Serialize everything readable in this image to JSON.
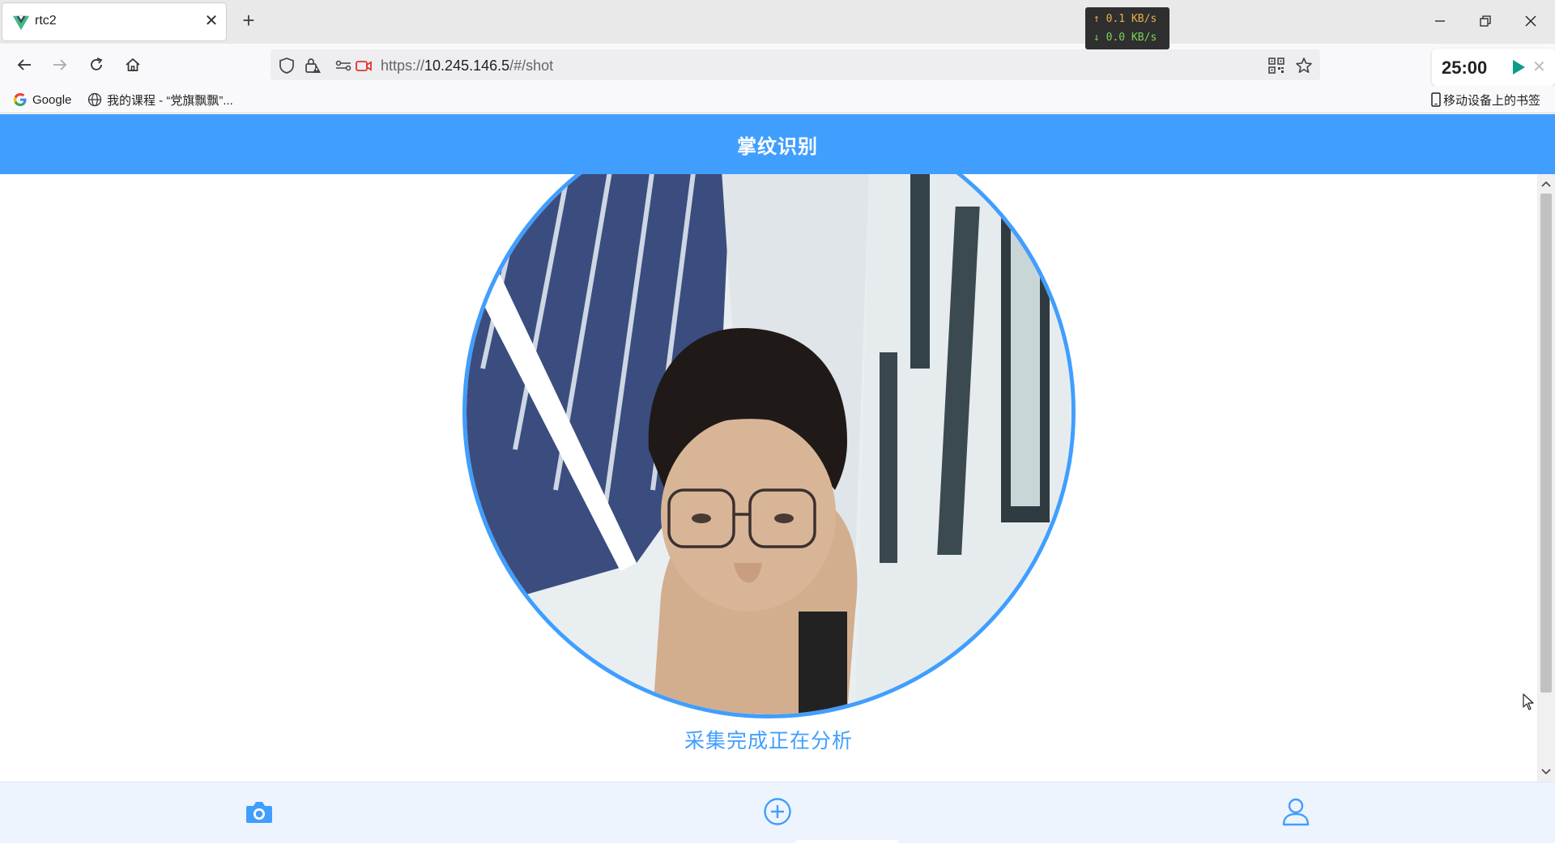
{
  "browser": {
    "tab": {
      "title": "rtc2",
      "favicon": "vue-logo-icon",
      "close_glyph": "✕"
    },
    "new_tab_glyph": "+",
    "net_speed": {
      "upload": "↑ 0.1 KB/s",
      "download": "↓ 0.0 KB/s",
      "upload_color": "#e8b04a",
      "download_color": "#7bd35a"
    },
    "url": {
      "prefix": "https://",
      "host": "10.245.146.5",
      "path": "/#/shot"
    },
    "timer": {
      "value": "25:00",
      "play_color": "#0f9a8a",
      "close_glyph": "✕"
    },
    "bookmarks": [
      {
        "label": "Google",
        "icon": "google-g-icon"
      },
      {
        "label": "我的课程 - “党旗飘飘”...",
        "icon": "globe-icon"
      }
    ],
    "mobile_bookmarks": {
      "label": "移动设备上的书签",
      "icon": "mobile-device-icon"
    }
  },
  "app": {
    "title": "掌纹识别",
    "accent_color": "#409eff",
    "status_text": "采集完成正在分析",
    "camera_preview": "live-camera-feed",
    "tabbar": [
      {
        "name": "capture",
        "icon": "camera-icon",
        "active": true
      },
      {
        "name": "add",
        "icon": "plus-circle-icon",
        "active": false
      },
      {
        "name": "profile",
        "icon": "user-icon",
        "active": false
      }
    ]
  }
}
